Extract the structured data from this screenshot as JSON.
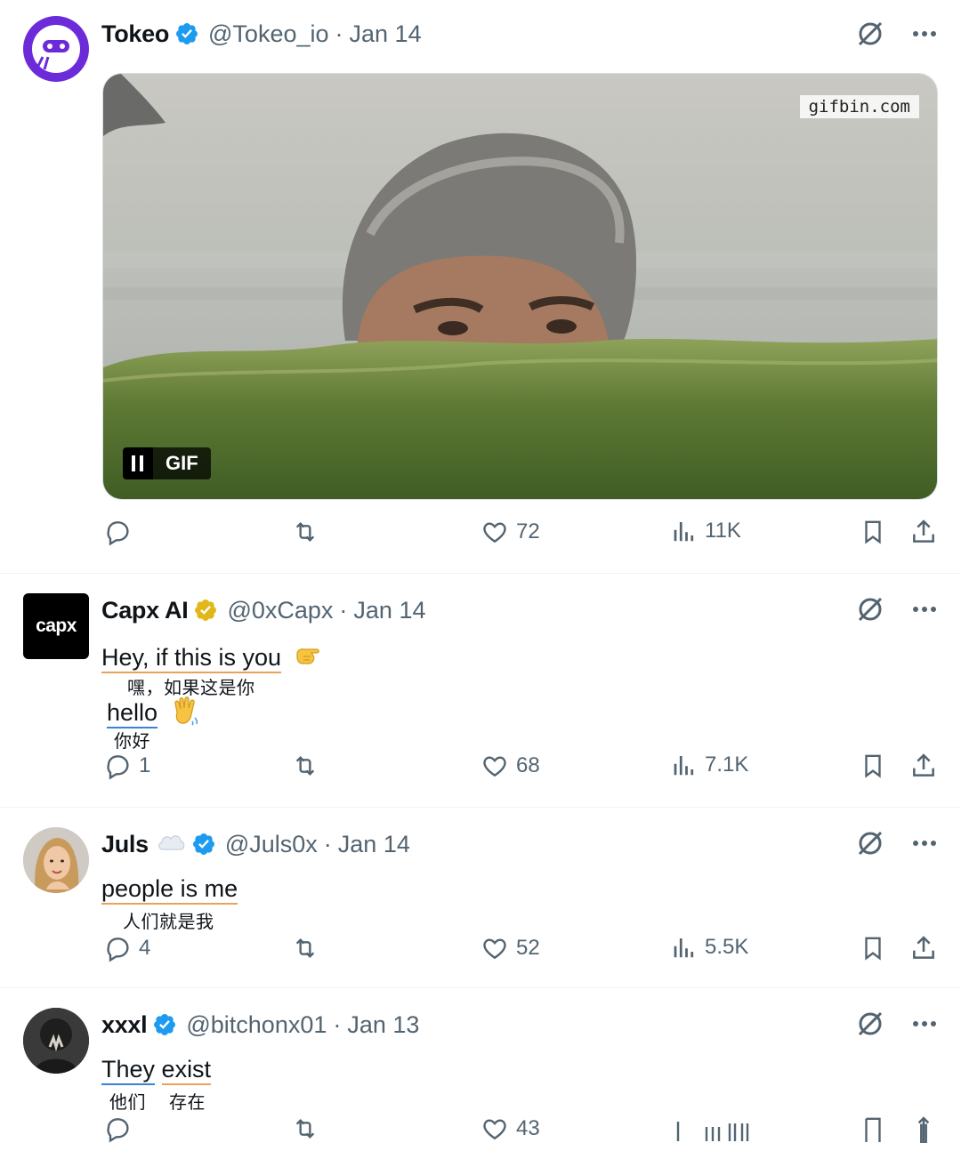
{
  "posts": [
    {
      "author_name": "Tokeo",
      "handle": "@Tokeo_io",
      "separator": "·",
      "date": "Jan 14",
      "media": {
        "watermark": "gifbin.com",
        "gif_label": "GIF"
      },
      "stats": {
        "replies": "",
        "likes": "72",
        "views": "11K"
      }
    },
    {
      "author_name": "Capx AI",
      "handle": "@0xCapx",
      "separator": "·",
      "date": "Jan 14",
      "avatar_text": "capx",
      "lines": [
        {
          "en": "Hey, if this is you",
          "zh": "嘿，如果这是你"
        },
        {
          "en": "hello",
          "zh": "你好"
        }
      ],
      "stats": {
        "replies": "1",
        "likes": "68",
        "views": "7.1K"
      }
    },
    {
      "author_name": "Juls",
      "handle": "@Juls0x",
      "separator": "·",
      "date": "Jan 14",
      "lines": [
        {
          "en": "people is me",
          "zh": "人们就是我"
        }
      ],
      "stats": {
        "replies": "4",
        "likes": "52",
        "views": "5.5K"
      }
    },
    {
      "author_name": "xxxl",
      "handle": "@bitchonx01",
      "separator": "·",
      "date": "Jan 13",
      "lines": [
        {
          "en_1": "They",
          "en_2": "exist",
          "zh_1": "他们",
          "zh_2": "存在"
        }
      ],
      "stats": {
        "replies": "",
        "likes": "43",
        "views": ""
      }
    }
  ],
  "colors": {
    "verified_blue": "#1d9bf0",
    "verified_gold": "#e2b719",
    "muted": "#536471",
    "brand_purple": "#6c2bd9"
  },
  "icons": [
    "reply-icon",
    "repost-icon",
    "like-icon",
    "views-icon",
    "bookmark-icon",
    "share-icon",
    "grok-icon",
    "more-icon"
  ]
}
